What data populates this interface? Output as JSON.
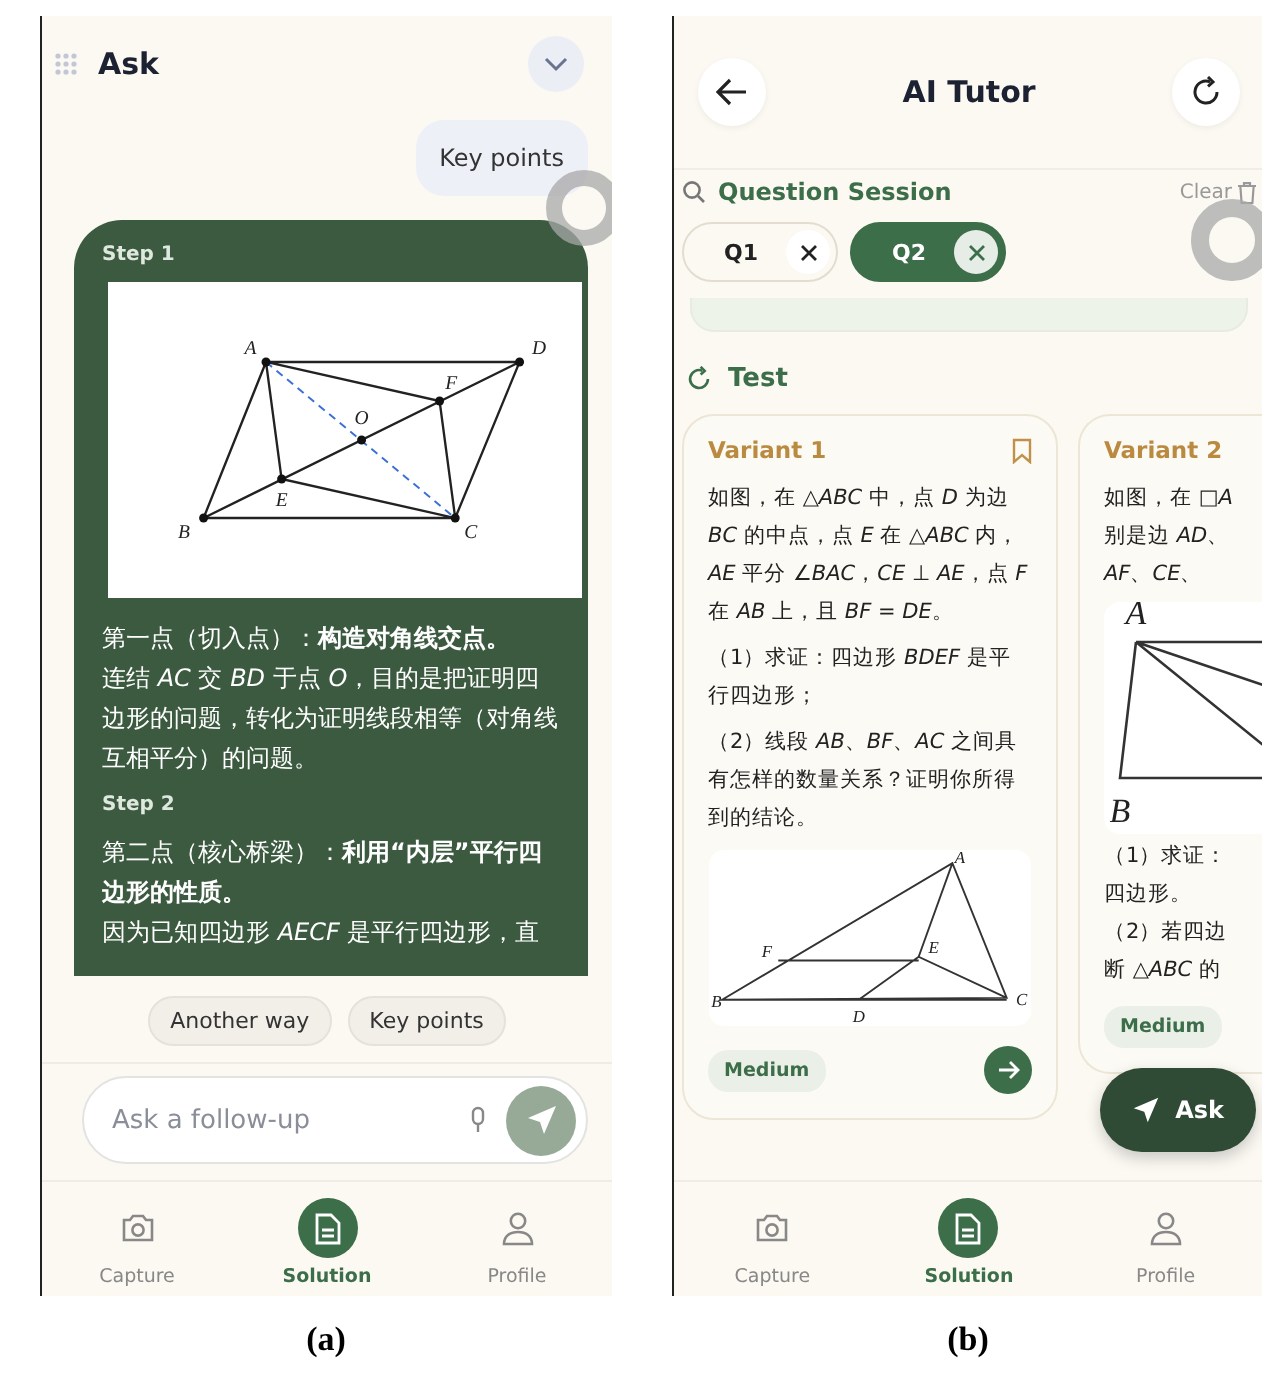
{
  "screen_a": {
    "header": {
      "title": "Ask"
    },
    "user_message": "Key points",
    "steps": [
      {
        "label": "Step 1",
        "figure": {
          "labels": [
            "A",
            "D",
            "F",
            "O",
            "E",
            "B",
            "C"
          ]
        },
        "paragraphs": [
          "第一点（切入点）：**构造对角线交点。**",
          "连结 *AC* 交 *BD* 于点 *O*，目的是把证明四边形的问题，转化为证明线段相等（对角线互相平分）的问题。"
        ]
      },
      {
        "label": "Step 2",
        "paragraphs": [
          "第二点（核心桥梁）：**利用“内层”平行四边形的性质。**",
          "因为已知四边形 *AECF* 是平行四边形，直"
        ]
      }
    ],
    "suggestions": [
      "Another way",
      "Key points"
    ],
    "input": {
      "placeholder": "Ask a follow-up"
    },
    "nav": [
      {
        "label": "Capture",
        "selected": false
      },
      {
        "label": "Solution",
        "selected": true
      },
      {
        "label": "Profile",
        "selected": false
      }
    ],
    "caption": "(a)"
  },
  "screen_b": {
    "header": {
      "title": "AI Tutor"
    },
    "session": {
      "title": "Question Session",
      "clear": "Clear",
      "tabs": [
        {
          "label": "Q1",
          "selected": false
        },
        {
          "label": "Q2",
          "selected": true
        }
      ]
    },
    "section_title": "Test",
    "variants": [
      {
        "title": "Variant 1",
        "bookmarked": false,
        "before": [
          "如图，在 △*ABC* 中，点 *D* 为边 *BC* 的中点，点 *E* 在 △*ABC* 内，*AE* 平分 ∠*BAC*，*CE* ⊥ *AE*，点 *F* 在 *AB* 上，且 *BF* = *DE*。",
          "（1）求证：四边形 *BDEF* 是平行四边形；",
          "（2）线段 *AB*、*BF*、*AC* 之间具有怎样的数量关系？证明你所得到的结论。"
        ],
        "figure": {
          "labels": [
            "A",
            "F",
            "E",
            "B",
            "D",
            "C"
          ]
        },
        "difficulty": "Medium"
      },
      {
        "title": "Variant 2",
        "before": [
          "如图，在 □*A*",
          "别是边 *AD*、",
          "*AF*、*CE*、"
        ],
        "figure": {
          "labels": [
            "A",
            "B"
          ]
        },
        "after": [
          "（1）求证：",
          "四边形。",
          "（2）若四边",
          "断 △*ABC* 的"
        ],
        "difficulty": "Medium"
      }
    ],
    "ask_button": "Ask",
    "nav": [
      {
        "label": "Capture",
        "selected": false
      },
      {
        "label": "Solution",
        "selected": true
      },
      {
        "label": "Profile",
        "selected": false
      }
    ],
    "caption": "(b)"
  }
}
